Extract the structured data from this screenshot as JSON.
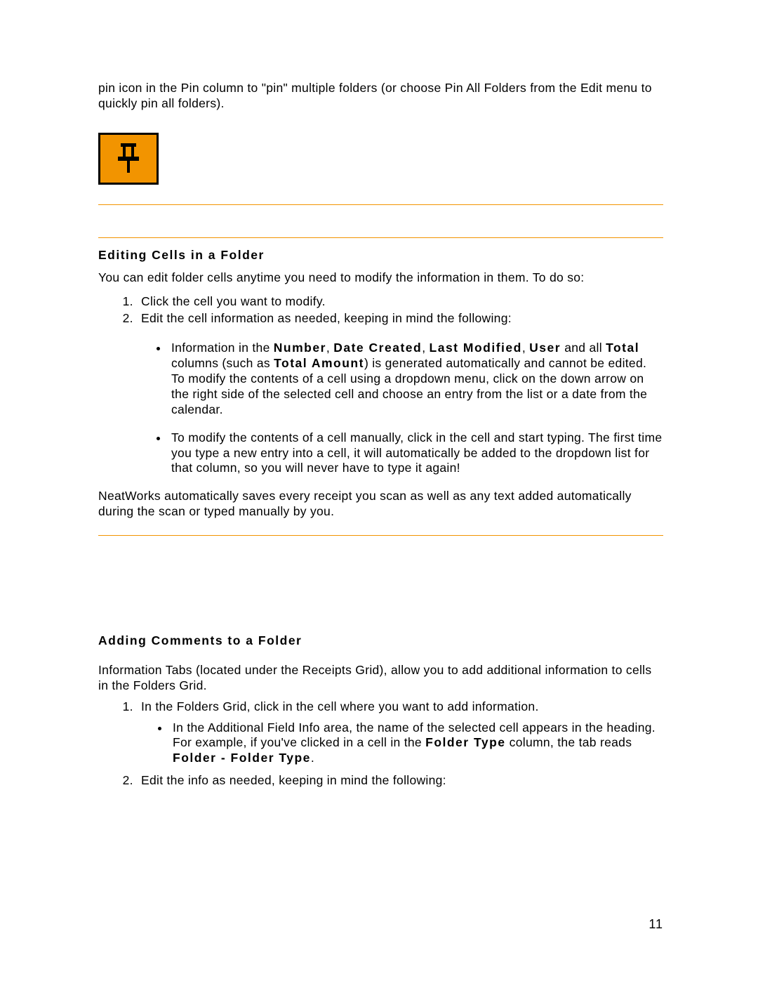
{
  "intro_para": "pin icon in the Pin column to \"pin\" multiple folders (or choose Pin All Folders from the Edit menu to quickly pin all folders).",
  "section1": {
    "heading": "Editing Cells in a Folder",
    "intro": "You can edit folder cells anytime you need to modify the information in them. To do so:",
    "step1": "Click the cell you want to modify.",
    "step2": "Edit the cell information as needed, keeping in mind the following:",
    "bullet1_pre": "Information in the ",
    "bullet1_b1": "Number",
    "bullet1_c1": ", ",
    "bullet1_b2": "Date Created",
    "bullet1_c2": ", ",
    "bullet1_b3": "Last Modified",
    "bullet1_c3": ", ",
    "bullet1_b4": "User",
    "bullet1_mid1": " and all ",
    "bullet1_b5": "Total",
    "bullet1_mid2": " columns (such as ",
    "bullet1_b6": "Total Amount",
    "bullet1_post": ") is generated automatically and cannot be edited.  To modify the contents of a cell using a dropdown menu, click on the down arrow on the right side of the selected cell and choose an entry from the list or a date from the calendar.",
    "bullet2": "To modify the contents of a cell manually, click in the cell and start typing. The first time you type a new entry into a cell, it will automatically be added to the dropdown list for that column, so you will never have to type it again!",
    "outro": "NeatWorks automatically saves every receipt you scan as well as any text added automatically during the scan or typed manually by you."
  },
  "section2": {
    "heading": "Adding Comments to a Folder",
    "intro": "Information Tabs (located under the Receipts Grid), allow you to add additional information to cells in the Folders Grid.",
    "step1": "In the Folders Grid, click in the cell where you want to add information.",
    "sub1_pre": "In the Additional Field Info area, the name of the selected cell appears in the heading. For example, if you've clicked in a cell in the ",
    "sub1_b1": "Folder Type",
    "sub1_mid": " column, the tab reads ",
    "sub1_b2": "Folder - Folder Type",
    "sub1_post": ".",
    "step2": "Edit the info as needed, keeping in mind the following:"
  },
  "page_number": "11"
}
